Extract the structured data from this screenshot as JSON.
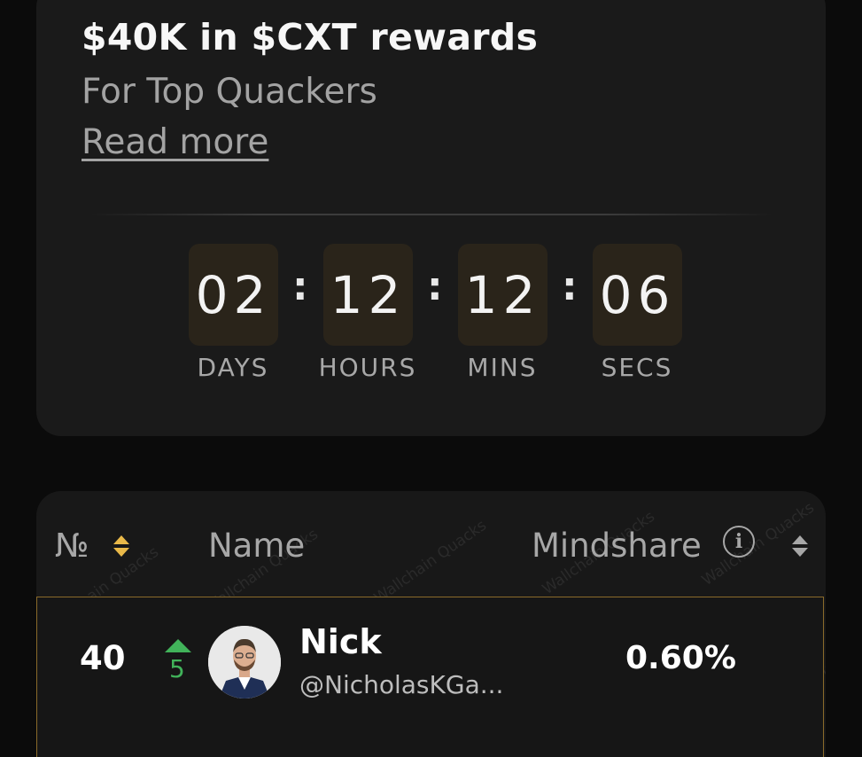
{
  "promo": {
    "title": "$40K in $CXT rewards",
    "subtitle": "For Top Quackers",
    "link": "Read more"
  },
  "countdown": {
    "days": "02",
    "hours": "12",
    "mins": "12",
    "secs": "06",
    "separator": ":",
    "labels": {
      "days": "DAYS",
      "hours": "HOURS",
      "mins": "MINS",
      "secs": "SECS"
    }
  },
  "leaderboard": {
    "columns": {
      "rank": "№",
      "name": "Name",
      "mindshare": "Mindshare"
    },
    "watermark": "Wallchain Quacks",
    "rows": [
      {
        "rank": "40",
        "rank_change": "5",
        "name": "Nick",
        "handle": "@NicholasKGa...",
        "mindshare": "0.60%"
      }
    ]
  },
  "colors": {
    "accent": "#e9b949",
    "up": "#41b35a",
    "card": "#1a1a1a",
    "highlight_border": "#8a6a2a"
  }
}
